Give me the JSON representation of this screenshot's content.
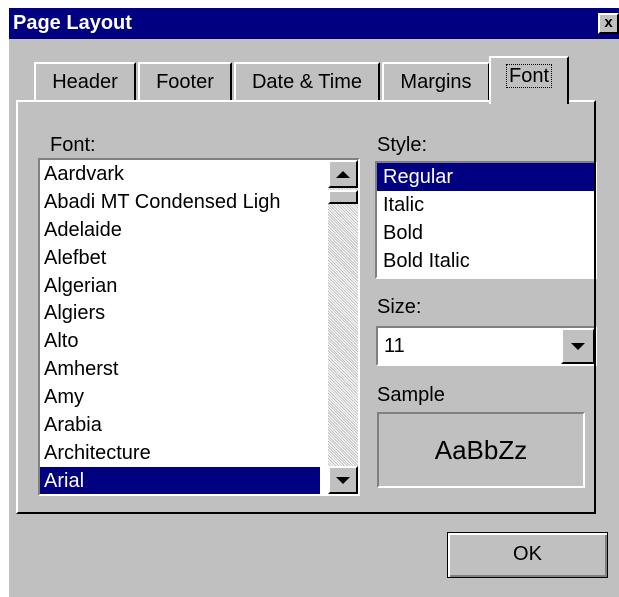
{
  "window": {
    "title": "Page Layout",
    "close_glyph": "x"
  },
  "tabs": [
    {
      "label": "Header",
      "active": false
    },
    {
      "label": "Footer",
      "active": false
    },
    {
      "label": "Date & Time",
      "active": false
    },
    {
      "label": "Margins",
      "active": false
    },
    {
      "label": "Font",
      "active": true
    }
  ],
  "font": {
    "label": "Font:",
    "items": [
      "Aardvark",
      "Abadi MT Condensed Ligh",
      "Adelaide",
      "Alefbet",
      "Algerian",
      "Algiers",
      "Alto",
      "Amherst",
      "Amy",
      "Arabia",
      "Architecture",
      "Arial"
    ],
    "selected": "Arial"
  },
  "style": {
    "label": "Style:",
    "items": [
      "Regular",
      "Italic",
      "Bold",
      "Bold Italic"
    ],
    "selected": "Regular"
  },
  "size": {
    "label": "Size:",
    "value": "11"
  },
  "sample": {
    "label": "Sample",
    "text": "AaBbZz"
  },
  "buttons": {
    "ok_label": "OK"
  },
  "colors": {
    "face": "#c0c0c0",
    "titlebar": "#000080",
    "selection": "#000080"
  },
  "icons": {
    "close": "close-icon",
    "scroll_up": "arrow-up-icon",
    "scroll_down": "arrow-down-icon",
    "combo": "chevron-down-icon"
  }
}
